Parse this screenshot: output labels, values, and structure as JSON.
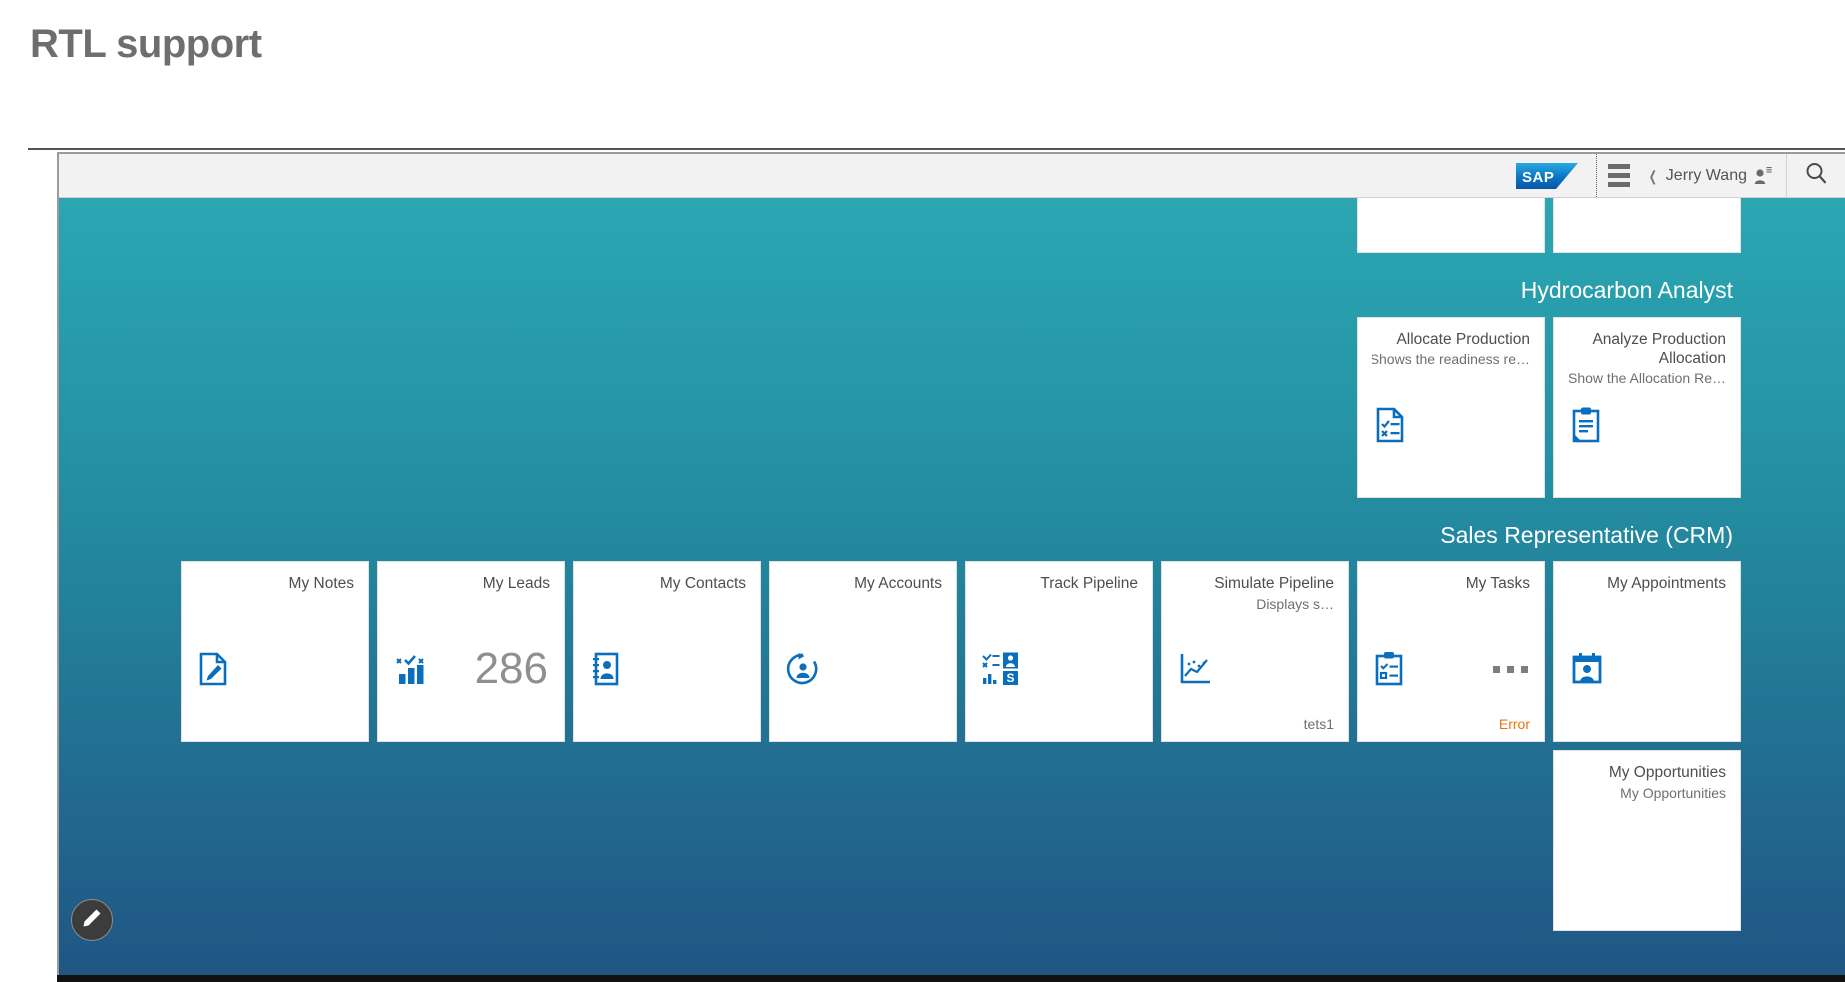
{
  "page": {
    "title": "RTL support"
  },
  "shellbar": {
    "user_name": "Jerry Wang",
    "user_icon": "user-menu-icon",
    "search_icon": "search-icon",
    "logo": "SAP",
    "menu_icon": "hamburger-menu-icon",
    "back_chevron": "chevron-left-icon"
  },
  "groups": [
    {
      "title": "",
      "tiles": [
        {
          "title": "",
          "subtitle": "",
          "icon": "sun-settings-icon",
          "number": "",
          "footer": "",
          "clipped": true
        },
        {
          "title": "",
          "subtitle": "",
          "icon": "gauge-icon",
          "number": "",
          "footer": "",
          "clipped": true
        }
      ]
    },
    {
      "title": "Hydrocarbon Analyst",
      "tiles": [
        {
          "title": "Analyze Production Allocation",
          "subtitle": "…Show the Allocation Re",
          "icon": "clipboard-text-icon",
          "number": "",
          "footer": ""
        },
        {
          "title": "Allocate Production",
          "subtitle": "…Shows the readiness re",
          "icon": "checklist-document-icon",
          "number": "",
          "footer": ""
        }
      ]
    },
    {
      "title": "(Sales Representative (CRM",
      "tiles": [
        {
          "title": "My Leads",
          "subtitle": "",
          "icon": "bar-chart-check-icon",
          "number": "286",
          "footer": ""
        },
        {
          "title": "My Contacts",
          "subtitle": "",
          "icon": "address-book-icon",
          "number": "",
          "footer": ""
        },
        {
          "title": "My Accounts",
          "subtitle": "",
          "icon": "account-refresh-icon",
          "number": "",
          "footer": ""
        },
        {
          "title": "Track Pipeline",
          "subtitle": "",
          "icon": "pipeline-grid-icon",
          "number": "",
          "footer": ""
        },
        {
          "title": "Simulate Pipeline",
          "subtitle": "…Displays s",
          "icon": "line-chart-icon",
          "number": "",
          "footer": "tets1"
        },
        {
          "title": "My Tasks",
          "subtitle": "",
          "icon": "task-clipboard-icon",
          "number": "",
          "footer": "Error",
          "footer_state": "error",
          "loading_dots": true
        },
        {
          "title": "My Appointments",
          "subtitle": "",
          "icon": "calendar-person-icon",
          "number": "",
          "footer": ""
        },
        {
          "title": "My Notes",
          "subtitle": "",
          "icon": "note-pencil-icon",
          "number": "",
          "footer": ""
        },
        {
          "title": "My Opportunities",
          "subtitle": "My Opportunities",
          "icon": "",
          "number": "",
          "footer": "",
          "blank": true
        }
      ]
    }
  ],
  "edit_button": {
    "icon": "pencil-icon",
    "label": ""
  },
  "colors": {
    "canvas_top": "#2ba6b2",
    "canvas_bottom": "#1f5683",
    "tile_icon": "#0a6ebe",
    "error": "#e9730c",
    "title_gray": "#6e6e6e",
    "sap_blue": "#0a6ebe"
  }
}
